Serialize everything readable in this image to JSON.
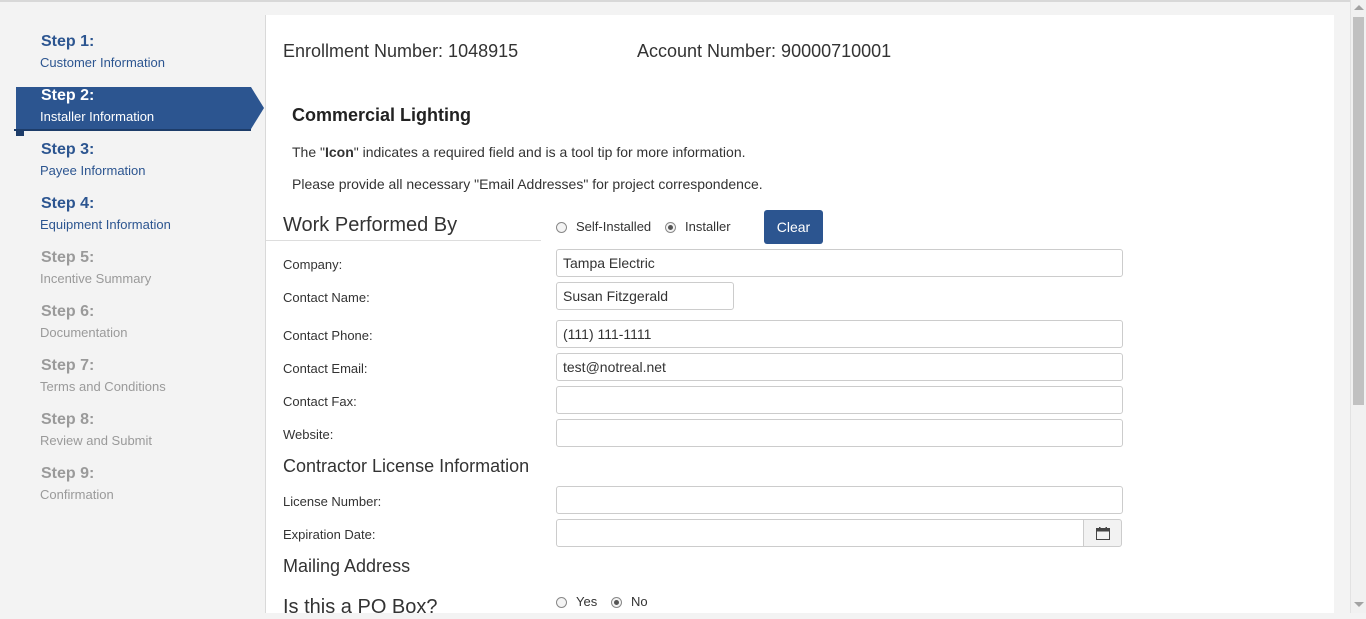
{
  "sidebar": {
    "steps": [
      {
        "num": "Step 1:",
        "label": "Customer Information"
      },
      {
        "num": "Step 2:",
        "label": "Installer Information"
      },
      {
        "num": "Step 3:",
        "label": "Payee Information"
      },
      {
        "num": "Step 4:",
        "label": "Equipment Information"
      },
      {
        "num": "Step 5:",
        "label": "Incentive Summary"
      },
      {
        "num": "Step 6:",
        "label": "Documentation"
      },
      {
        "num": "Step 7:",
        "label": "Terms and Conditions"
      },
      {
        "num": "Step 8:",
        "label": "Review and Submit"
      },
      {
        "num": "Step 9:",
        "label": "Confirmation"
      }
    ]
  },
  "header": {
    "enrollment": "Enrollment Number: 1048915",
    "account": "Account Number: 90000710001"
  },
  "main": {
    "title": "Commercial Lighting",
    "note1_pre": "The \"",
    "note1_bold": "Icon",
    "note1_post": "\" indicates a required field and is a tool tip for more information.",
    "note2": "Please provide all necessary \"Email Addresses\" for project correspondence."
  },
  "work": {
    "heading": "Work Performed By",
    "self_label": "Self-Installed",
    "installer_label": "Installer",
    "clear_label": "Clear"
  },
  "fields": {
    "company_label": "Company:",
    "company_value": "Tampa Electric",
    "contact_name_label": "Contact Name:",
    "contact_name_value": "Susan Fitzgerald",
    "phone_label": "Contact Phone:",
    "phone_value": "(111) 111-1111",
    "email_label": "Contact Email:",
    "email_value": "test@notreal.net",
    "fax_label": "Contact Fax:",
    "fax_value": "",
    "website_label": "Website:",
    "website_value": ""
  },
  "license": {
    "heading": "Contractor License Information",
    "number_label": "License Number:",
    "number_value": "",
    "exp_label": "Expiration Date:",
    "exp_value": ""
  },
  "mailing": {
    "heading": "Mailing Address",
    "po_box_question": "Is this a PO Box?",
    "yes_label": "Yes",
    "no_label": "No"
  },
  "colors": {
    "accent": "#2c5590"
  }
}
